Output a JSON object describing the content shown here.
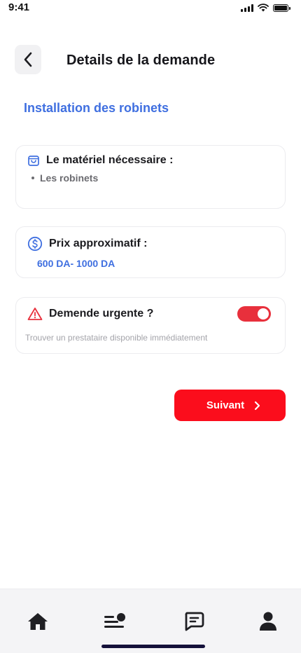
{
  "status_bar": {
    "time": "9:41"
  },
  "header": {
    "back_icon": "chevron-left-icon",
    "title": "Details de la demande"
  },
  "service": {
    "title": "Installation des robinets"
  },
  "materiel": {
    "icon": "shopping-bag-icon",
    "heading": "Le matériel nécessaire :",
    "items": [
      "Les robinets"
    ]
  },
  "prix": {
    "icon": "dollar-circle-icon",
    "heading": "Prix approximatif :",
    "value": "600 DA- 1000 DA"
  },
  "urgent": {
    "icon": "warning-triangle-icon",
    "heading": "Demende urgente ?",
    "description": "Trouver un prestataire disponible immédiatement",
    "toggle_on": true
  },
  "next_button": {
    "label": "Suivant",
    "icon": "chevron-right-icon"
  },
  "bottom_nav": {
    "items": [
      {
        "name": "home",
        "icon": "home-icon"
      },
      {
        "name": "requests",
        "icon": "list-badge-icon"
      },
      {
        "name": "messages",
        "icon": "chat-icon"
      },
      {
        "name": "profile",
        "icon": "user-icon"
      }
    ]
  },
  "colors": {
    "accent_blue": "#3f6fe0",
    "primary_red": "#fb0d1c",
    "toggle_red": "#e8303c",
    "nav_bg": "#f4f4f6"
  }
}
